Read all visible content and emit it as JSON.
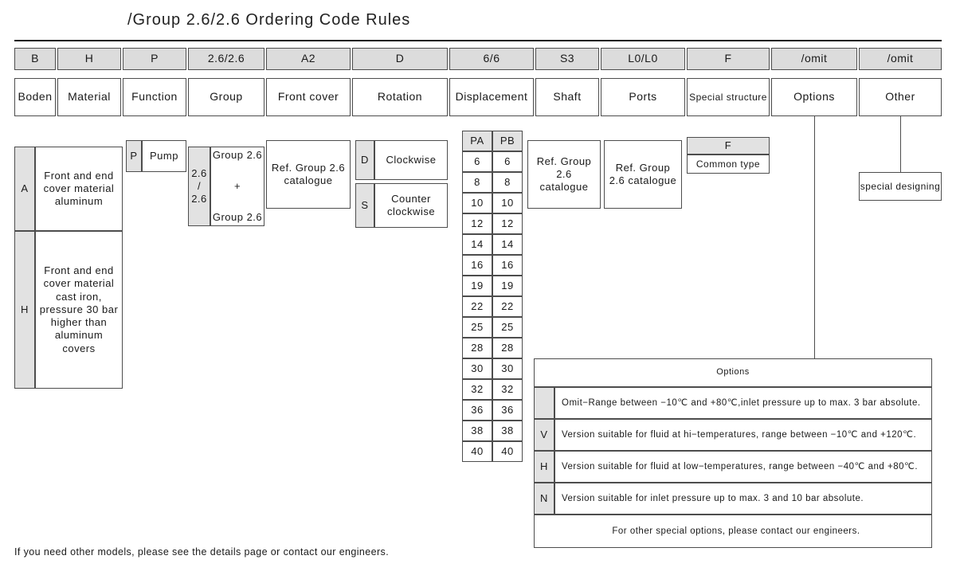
{
  "title": "/Group 2.6/2.6 Ordering Code Rules",
  "code_row": [
    {
      "code": "B"
    },
    {
      "code": "H"
    },
    {
      "code": "P"
    },
    {
      "code": "2.6/2.6"
    },
    {
      "code": "A2"
    },
    {
      "code": "D"
    },
    {
      "code": "6/6"
    },
    {
      "code": "S3"
    },
    {
      "code": "L0/L0"
    },
    {
      "code": "F"
    },
    {
      "code": "/omit"
    },
    {
      "code": "/omit"
    }
  ],
  "label_row": [
    "Boden",
    "Material",
    "Function",
    "Group",
    "Front cover",
    "Rotation",
    "Displacement",
    "Shaft",
    "Ports",
    "Special structure",
    "Options",
    "Other"
  ],
  "material": {
    "rows": [
      {
        "key": "A",
        "text": "Front and end cover material aluminum"
      },
      {
        "key": "H",
        "text": "Front and end cover material cast iron, pressure 30 bar higher than aluminum covers"
      }
    ]
  },
  "function": {
    "key": "P",
    "text": "Pump"
  },
  "group": {
    "key_lines": [
      "2.6",
      "/",
      "2.6"
    ],
    "text_lines": [
      "Group  2.6",
      "+",
      "Group  2.6"
    ]
  },
  "front_cover": {
    "text": "Ref. Group 2.6 catalogue"
  },
  "rotation": {
    "rows": [
      {
        "key": "D",
        "text": "Clockwise"
      },
      {
        "key": "S",
        "text": "Counter clockwise"
      }
    ]
  },
  "displacement": {
    "headers": [
      "PA",
      "PB"
    ],
    "rows": [
      [
        "6",
        "6"
      ],
      [
        "8",
        "8"
      ],
      [
        "10",
        "10"
      ],
      [
        "12",
        "12"
      ],
      [
        "14",
        "14"
      ],
      [
        "16",
        "16"
      ],
      [
        "19",
        "19"
      ],
      [
        "22",
        "22"
      ],
      [
        "25",
        "25"
      ],
      [
        "28",
        "28"
      ],
      [
        "30",
        "30"
      ],
      [
        "32",
        "32"
      ],
      [
        "36",
        "36"
      ],
      [
        "38",
        "38"
      ],
      [
        "40",
        "40"
      ]
    ]
  },
  "shaft": {
    "text": "Ref. Group 2.6 catalogue"
  },
  "ports": {
    "text": "Ref. Group 2.6 catalogue"
  },
  "special_structure": {
    "key": "F",
    "text": "Common type"
  },
  "other": {
    "text": "special designing"
  },
  "options_table": {
    "title": "Options",
    "rows": [
      {
        "key": "",
        "text": "Omit−Range between −10℃ and +80℃,inlet pressure up to max. 3 bar absolute."
      },
      {
        "key": "V",
        "text": "Version suitable for fluid at hi−temperatures, range between −10℃ and +120℃."
      },
      {
        "key": "H",
        "text": "Version suitable for fluid at low−temperatures, range between −40℃ and +80℃."
      },
      {
        "key": "N",
        "text": "Version suitable for inlet pressure up to max. 3 and 10 bar absolute."
      }
    ],
    "footer": "For other special options, please contact our engineers."
  },
  "footer_note": "If you need other models, please see the details page or contact our engineers."
}
